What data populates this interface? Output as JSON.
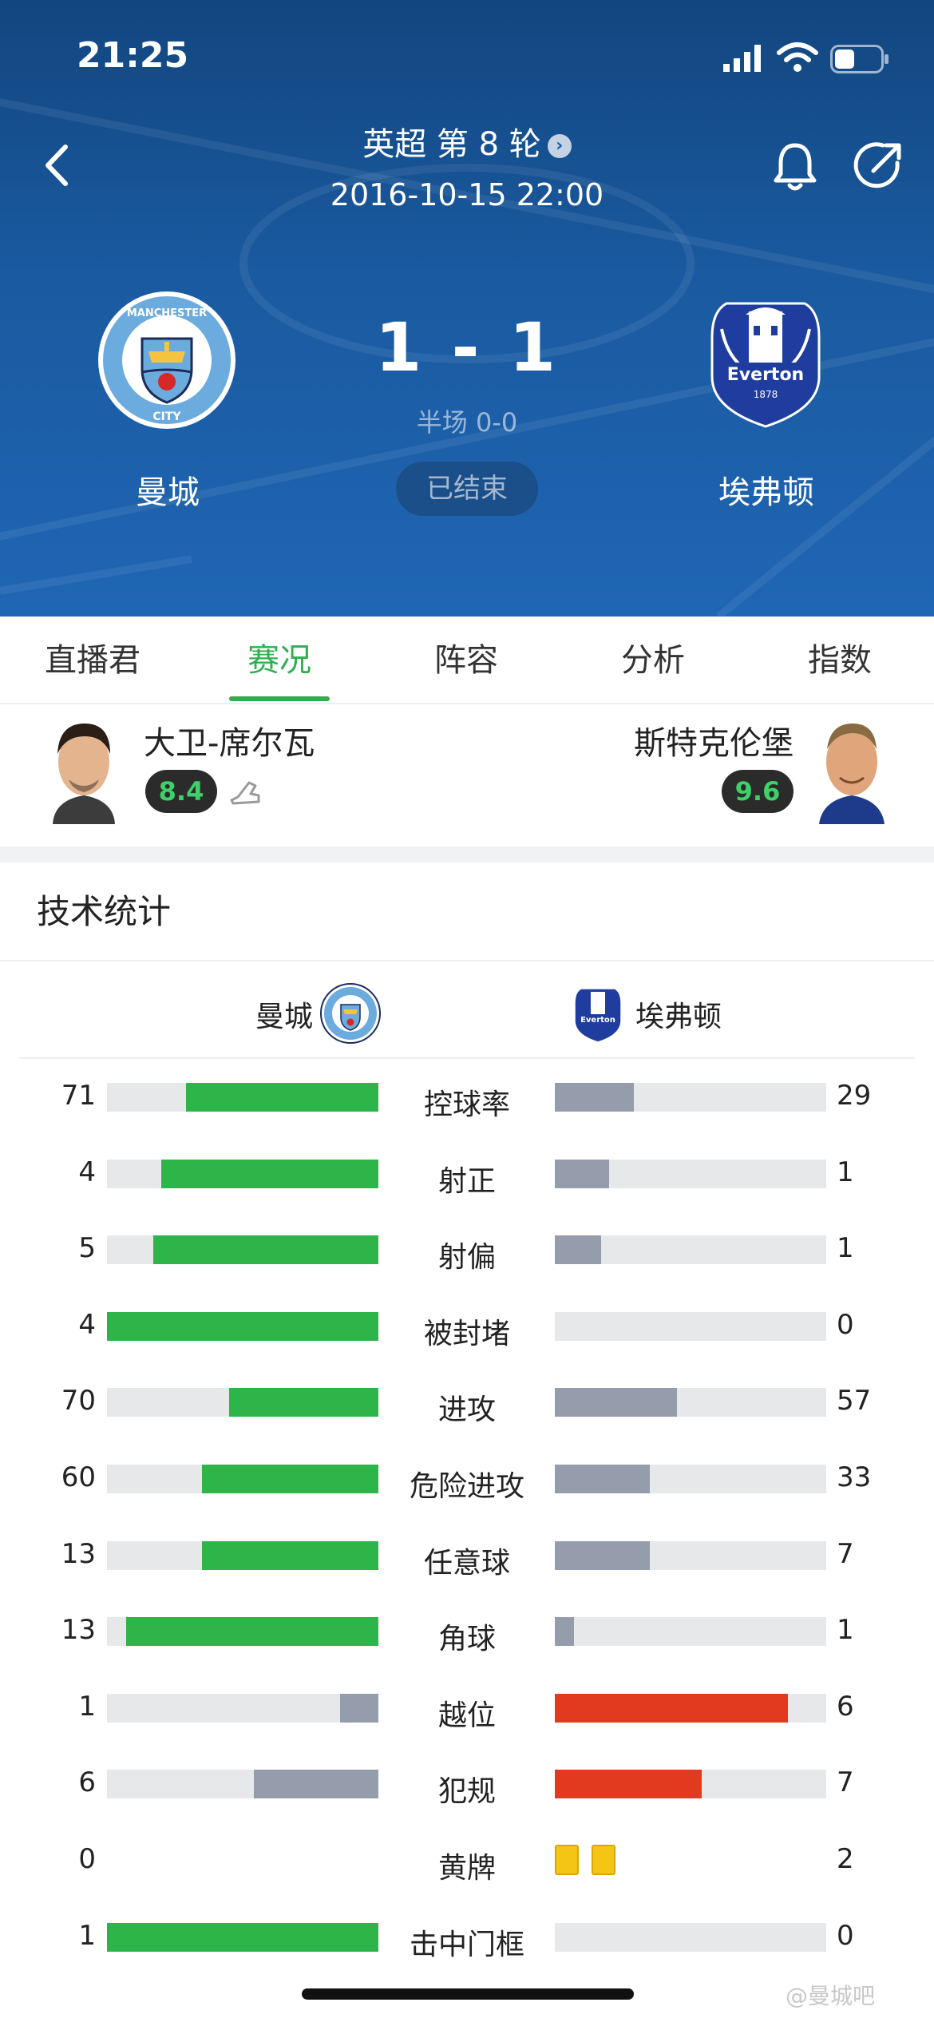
{
  "status_bar": {
    "time": "21:25"
  },
  "match": {
    "league": "英超 第 8 轮",
    "datetime": "2016-10-15 22:00",
    "home_team": "曼城",
    "away_team": "埃弗顿",
    "score": "1 - 1",
    "halftime": "半场 0-0",
    "status": "已结束",
    "home_crest_text": "MANCHESTER CITY",
    "away_crest_text": "Everton 1878 NIL SATIS NISI OPTIMUM"
  },
  "tabs": [
    {
      "label": "直播君",
      "active": false
    },
    {
      "label": "赛况",
      "active": true
    },
    {
      "label": "阵容",
      "active": false
    },
    {
      "label": "分析",
      "active": false
    },
    {
      "label": "指数",
      "active": false
    }
  ],
  "players": {
    "home": {
      "name": "大卫-席尔瓦",
      "rating": "8.4"
    },
    "away": {
      "name": "斯特克伦堡",
      "rating": "9.6"
    }
  },
  "stats_section": {
    "title": "技术统计",
    "home_team": "曼城",
    "away_team": "埃弗顿"
  },
  "colors": {
    "home_bar": "#2db54a",
    "away_bar": "#959cab",
    "away_bar_highlight": "#e23a1e",
    "home_bar_muted": "#959cab",
    "track": "#e7e8ea",
    "accent": "#2fae4e"
  },
  "stats": [
    {
      "label": "控球率",
      "home": "71",
      "away": "29",
      "home_frac": 0.71,
      "away_frac": 0.29,
      "home_color": "green",
      "away_color": "grey"
    },
    {
      "label": "射正",
      "home": "4",
      "away": "1",
      "home_frac": 0.8,
      "away_frac": 0.2,
      "home_color": "green",
      "away_color": "grey"
    },
    {
      "label": "射偏",
      "home": "5",
      "away": "1",
      "home_frac": 0.83,
      "away_frac": 0.17,
      "home_color": "green",
      "away_color": "grey"
    },
    {
      "label": "被封堵",
      "home": "4",
      "away": "0",
      "home_frac": 1.0,
      "away_frac": 0.0,
      "home_color": "green",
      "away_color": "grey"
    },
    {
      "label": "进攻",
      "home": "70",
      "away": "57",
      "home_frac": 0.55,
      "away_frac": 0.45,
      "home_color": "green",
      "away_color": "grey"
    },
    {
      "label": "危险进攻",
      "home": "60",
      "away": "33",
      "home_frac": 0.65,
      "away_frac": 0.35,
      "home_color": "green",
      "away_color": "grey"
    },
    {
      "label": "任意球",
      "home": "13",
      "away": "7",
      "home_frac": 0.65,
      "away_frac": 0.35,
      "home_color": "green",
      "away_color": "grey"
    },
    {
      "label": "角球",
      "home": "13",
      "away": "1",
      "home_frac": 0.93,
      "away_frac": 0.07,
      "home_color": "green",
      "away_color": "grey"
    },
    {
      "label": "越位",
      "home": "1",
      "away": "6",
      "home_frac": 0.14,
      "away_frac": 0.86,
      "home_color": "grey",
      "away_color": "red"
    },
    {
      "label": "犯规",
      "home": "6",
      "away": "7",
      "home_frac": 0.46,
      "away_frac": 0.54,
      "home_color": "grey",
      "away_color": "red"
    },
    {
      "label": "黄牌",
      "home": "0",
      "away": "2",
      "home_cards": 0,
      "away_cards": 2
    },
    {
      "label": "击中门框",
      "home": "1",
      "away": "0",
      "home_frac": 1.0,
      "away_frac": 0.0,
      "home_color": "green",
      "away_color": "grey"
    }
  ],
  "watermark": "@曼城吧"
}
